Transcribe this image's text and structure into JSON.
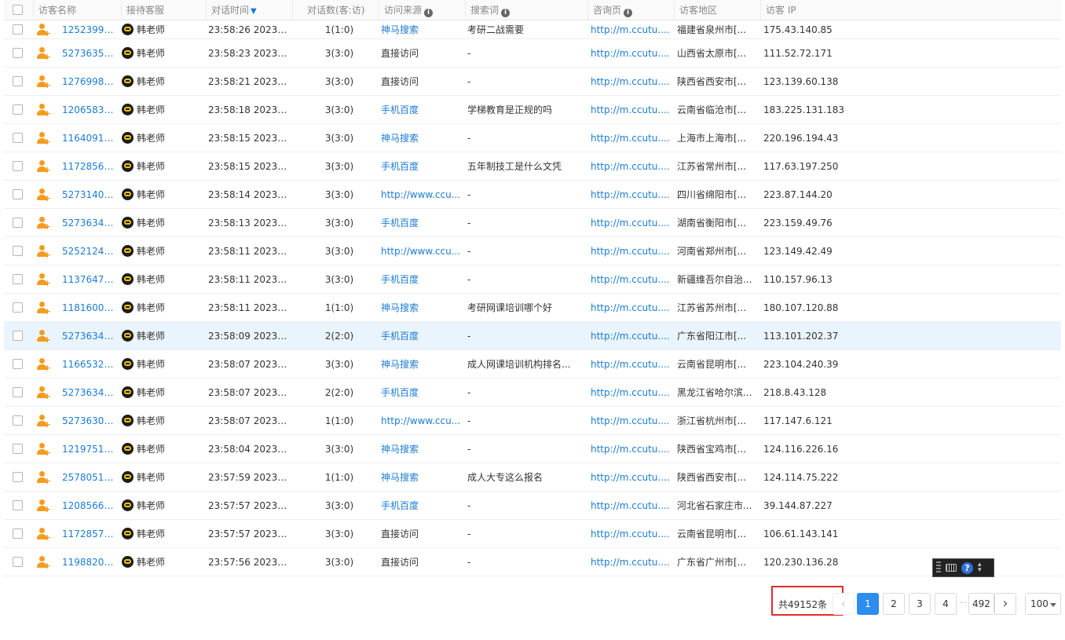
{
  "headers": {
    "visitor_name": "访客名称",
    "agent": "接待客服",
    "time": "对话时间",
    "time_sort_icon": "▼",
    "count": "对话数(客:访)",
    "source": "访问来源",
    "keyword": "搜索词",
    "page": "咨询页",
    "region": "访客地区",
    "ip": "访客 IP"
  },
  "rows": [
    {
      "name": "12523995...",
      "agent": "韩老师",
      "time": "23:58:26 2023-...",
      "count": "1(1:0)",
      "source": "神马搜索",
      "source_link": true,
      "keyword": "考研二战需要",
      "page": "http://m.ccutu....",
      "region": "福建省泉州市[...",
      "ip": "175.43.140.85"
    },
    {
      "name": "52736353...",
      "agent": "韩老师",
      "time": "23:58:23 2023-...",
      "count": "3(3:0)",
      "source": "直接访问",
      "source_link": false,
      "keyword": "-",
      "page": "http://m.ccutu....",
      "region": "山西省太原市[...",
      "ip": "111.52.72.171"
    },
    {
      "name": "12769984...",
      "agent": "韩老师",
      "time": "23:58:21 2023-...",
      "count": "3(3:0)",
      "source": "直接访问",
      "source_link": false,
      "keyword": "-",
      "page": "http://m.ccutu....",
      "region": "陕西省西安市[...",
      "ip": "123.139.60.138"
    },
    {
      "name": "12065835...",
      "agent": "韩老师",
      "time": "23:58:18 2023-...",
      "count": "3(3:0)",
      "source": "手机百度",
      "source_link": true,
      "keyword": "学梯教育是正规的吗",
      "page": "http://m.ccutu....",
      "region": "云南省临沧市[...",
      "ip": "183.225.131.183"
    },
    {
      "name": "11640918...",
      "agent": "韩老师",
      "time": "23:58:15 2023-...",
      "count": "3(3:0)",
      "source": "神马搜索",
      "source_link": true,
      "keyword": "-",
      "page": "http://m.ccutu....",
      "region": "上海市上海市[...",
      "ip": "220.196.194.43"
    },
    {
      "name": "11728566...",
      "agent": "韩老师",
      "time": "23:58:15 2023-...",
      "count": "3(3:0)",
      "source": "手机百度",
      "source_link": true,
      "keyword": "五年制技工是什么文凭",
      "page": "http://m.ccutu....",
      "region": "江苏省常州市[...",
      "ip": "117.63.197.250"
    },
    {
      "name": "52731408...",
      "agent": "韩老师",
      "time": "23:58:14 2023-...",
      "count": "3(3:0)",
      "source": "http://www.ccu...",
      "source_link": true,
      "keyword": "-",
      "page": "http://m.ccutu....",
      "region": "四川省绵阳市[...",
      "ip": "223.87.144.20"
    },
    {
      "name": "52736346...",
      "agent": "韩老师",
      "time": "23:58:13 2023-...",
      "count": "3(3:0)",
      "source": "手机百度",
      "source_link": true,
      "keyword": "-",
      "page": "http://m.ccutu....",
      "region": "湖南省衡阳市[...",
      "ip": "223.159.49.76"
    },
    {
      "name": "52521243...",
      "agent": "韩老师",
      "time": "23:58:11 2023-...",
      "count": "3(3:0)",
      "source": "http://www.ccu...",
      "source_link": true,
      "keyword": "-",
      "page": "http://m.ccutu....",
      "region": "河南省郑州市[...",
      "ip": "123.149.42.49"
    },
    {
      "name": "11376478...",
      "agent": "韩老师",
      "time": "23:58:11 2023-...",
      "count": "3(3:0)",
      "source": "手机百度",
      "source_link": true,
      "keyword": "-",
      "page": "http://m.ccutu....",
      "region": "新疆维吾尔自治...",
      "ip": "110.157.96.13"
    },
    {
      "name": "11816001...",
      "agent": "韩老师",
      "time": "23:58:11 2023-...",
      "count": "1(1:0)",
      "source": "神马搜索",
      "source_link": true,
      "keyword": "考研网课培训哪个好",
      "page": "http://m.ccutu....",
      "region": "江苏省苏州市[...",
      "ip": "180.107.120.88"
    },
    {
      "name": "52736343...",
      "agent": "韩老师",
      "time": "23:58:09 2023-...",
      "count": "2(2:0)",
      "source": "手机百度",
      "source_link": true,
      "keyword": "-",
      "page": "http://m.ccutu....",
      "region": "广东省阳江市[...",
      "ip": "113.101.202.37"
    },
    {
      "name": "11665322...",
      "agent": "韩老师",
      "time": "23:58:07 2023-...",
      "count": "3(3:0)",
      "source": "神马搜索",
      "source_link": true,
      "keyword": "成人网课培训机构排名...",
      "page": "http://m.ccutu....",
      "region": "云南省昆明市[...",
      "ip": "223.104.240.39"
    },
    {
      "name": "52736340...",
      "agent": "韩老师",
      "time": "23:58:07 2023-...",
      "count": "2(2:0)",
      "source": "手机百度",
      "source_link": true,
      "keyword": "-",
      "page": "http://m.ccutu....",
      "region": "黑龙江省哈尔滨...",
      "ip": "218.8.43.128"
    },
    {
      "name": "52736301...",
      "agent": "韩老师",
      "time": "23:58:07 2023-...",
      "count": "1(1:0)",
      "source": "http://www.ccu...",
      "source_link": true,
      "keyword": "-",
      "page": "http://m.ccutu....",
      "region": "浙江省杭州市[...",
      "ip": "117.147.6.121"
    },
    {
      "name": "12197511...",
      "agent": "韩老师",
      "time": "23:58:04 2023-...",
      "count": "3(3:0)",
      "source": "神马搜索",
      "source_link": true,
      "keyword": "-",
      "page": "http://m.ccutu....",
      "region": "陕西省宝鸡市[...",
      "ip": "124.116.226.16"
    },
    {
      "name": "25780512...",
      "agent": "韩老师",
      "time": "23:57:59 2023-...",
      "count": "1(1:0)",
      "source": "神马搜索",
      "source_link": true,
      "keyword": "成人大专这么报名",
      "page": "http://m.ccutu....",
      "region": "陕西省西安市[...",
      "ip": "124.114.75.222"
    },
    {
      "name": "12085662...",
      "agent": "韩老师",
      "time": "23:57:57 2023-...",
      "count": "3(3:0)",
      "source": "手机百度",
      "source_link": true,
      "keyword": "-",
      "page": "http://m.ccutu....",
      "region": "河北省石家庄市...",
      "ip": "39.144.87.227"
    },
    {
      "name": "11728575...",
      "agent": "韩老师",
      "time": "23:57:57 2023-...",
      "count": "3(3:0)",
      "source": "直接访问",
      "source_link": false,
      "keyword": "-",
      "page": "http://m.ccutu....",
      "region": "云南省昆明市[...",
      "ip": "106.61.143.141"
    },
    {
      "name": "11988207...",
      "agent": "韩老师",
      "time": "23:57:56 2023-...",
      "count": "3(3:0)",
      "source": "直接访问",
      "source_link": false,
      "keyword": "-",
      "page": "http://m.ccutu....",
      "region": "广东省广州市[...",
      "ip": "120.230.136.28"
    }
  ],
  "highlighted_row": 11,
  "pagination": {
    "total": "共49152条",
    "prev_icon": "chevron-left",
    "pages": [
      "1",
      "2",
      "3",
      "4"
    ],
    "ellipsis": "···",
    "last_page": "492",
    "active_page": "1",
    "next_icon": "chevron-right",
    "page_size": "100"
  },
  "ime_toolbar": {
    "help": "?"
  },
  "colors": {
    "link": "#1b7bd6",
    "active_page": "#2d8cf0",
    "highlight_row": "#eaf4fc",
    "annotation_box": "#e02b2b",
    "user_icon": "#f39c1f"
  }
}
